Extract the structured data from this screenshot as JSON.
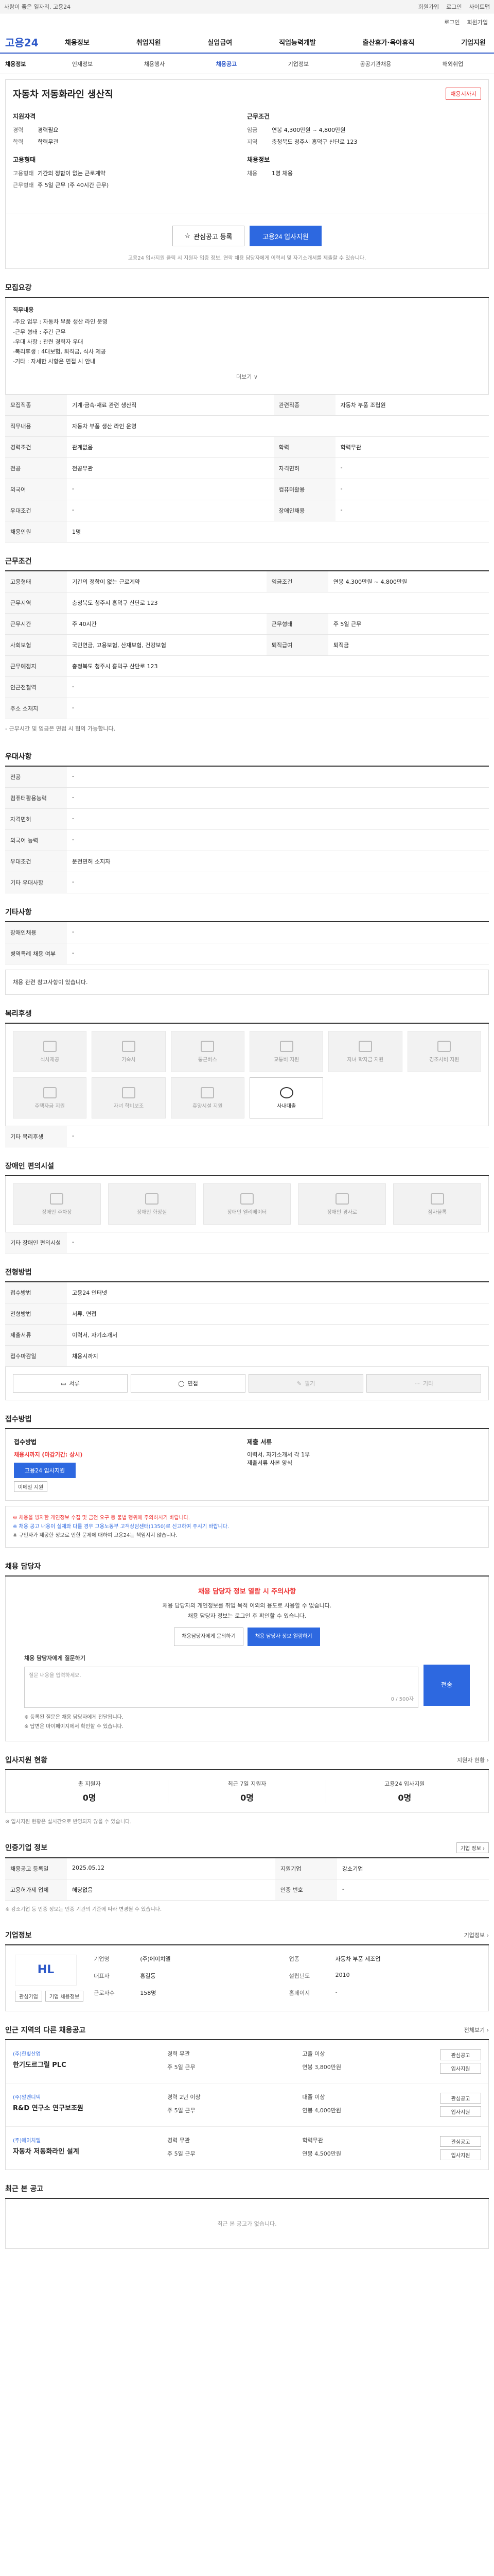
{
  "topbar": {
    "left": "사람이 좋은 일자리, 고용24",
    "items": [
      "회원가입",
      "로그인",
      "사이트맵"
    ]
  },
  "login_row": [
    "로그인",
    "회원가입"
  ],
  "brand": {
    "logo": "고용24"
  },
  "gnb": [
    "채용정보",
    "취업지원",
    "실업급여",
    "직업능력개발",
    "출산휴가·육아휴직",
    "기업지원"
  ],
  "subnav": {
    "title": "채용정보",
    "items": [
      "인재정보",
      "채용행사",
      "채용공고",
      "기업정보",
      "공공기관채용",
      "해외취업"
    ],
    "active": 2
  },
  "job": {
    "title": "자동차 저동화라인 생산직",
    "badge": "채용시까지",
    "left_h": "지원자격",
    "left_rows": [
      [
        "경력",
        "경력필요"
      ],
      [
        "학력",
        "학력무관"
      ]
    ],
    "left_h2": "고용형태",
    "left_rows2": [
      [
        "고용형태",
        "기간의 정함이 없는 근로계약"
      ],
      [
        "근무형태",
        "주 5일 근무 (주 40시간 근무)"
      ]
    ],
    "right_h": "근무조건",
    "right_rows": [
      [
        "임금",
        "연봉 4,300만원 ~ 4,800만원"
      ],
      [
        "지역",
        "충청북도 청주시 흥덕구 산단로 123"
      ]
    ],
    "right_h2": "채용정보",
    "right_rows2": [
      [
        "채용",
        "1명 채용"
      ]
    ],
    "btn_save": "관심공고 등록",
    "btn_apply": "고용24 입사지원",
    "notice": "고용24 입사지원 클릭 시 지원자 입증 정보, 연락 채용 담당자에게 이력서 및 자기소개서를 제출할 수 있습니다."
  },
  "duty": {
    "title": "모집요강",
    "label": "직무내용",
    "lines": [
      "-주요 업무 : 자동차 부품 생산 라인 운영",
      "-근무 형태 : 주간 근무",
      "-우대 사항 : 관련 경력자 우대",
      "-복리후생 : 4대보험, 퇴직금, 식사 제공",
      "-기타 : 자세한 사항은 면접 시 안내"
    ],
    "more": "더보기 ∨",
    "rows": [
      [
        "모집직종",
        "기계·금속·재료 관련 생산직",
        "관련직종",
        "자동차 부품 조립원"
      ],
      [
        "직무내용",
        "자동차 부품 생산 라인 운영",
        "",
        ""
      ],
      [
        "경력조건",
        "관계없음",
        "학력",
        "학력무관"
      ],
      [
        "전공",
        "전공무관",
        "자격면허",
        "-"
      ],
      [
        "외국어",
        "-",
        "컴퓨터활용",
        "-"
      ],
      [
        "우대조건",
        "-",
        "장애인채용",
        "-"
      ],
      [
        "채용인원",
        "1명",
        "",
        ""
      ]
    ]
  },
  "cond": {
    "title": "근무조건",
    "rows": [
      [
        "고용형태",
        "기간의 정함이 없는 근로계약",
        "임금조건",
        "연봉 4,300만원 ~ 4,800만원"
      ],
      [
        "근무지역",
        "충청북도 청주시 흥덕구 산단로 123",
        "",
        ""
      ],
      [
        "근무시간",
        "주 40시간",
        "근무형태",
        "주 5일 근무"
      ],
      [
        "사회보험",
        "국민연금, 고용보험, 산재보험, 건강보험",
        "퇴직급여",
        "퇴직금"
      ],
      [
        "근무예정지",
        "충청북도 청주시 흥덕구 산단로 123",
        "",
        ""
      ],
      [
        "인근전철역",
        "-",
        "",
        ""
      ],
      [
        "주소 소재지",
        "-",
        "",
        ""
      ]
    ],
    "map_btn": "지도 보기",
    "apply_btn": "고용24 입사지원",
    "note": "- 근무시간 및 임금은 면접 시 협의 가능합니다."
  },
  "prefer": {
    "title": "우대사항",
    "rows": [
      [
        "전공",
        "-"
      ],
      [
        "컴퓨터활용능력",
        "-"
      ],
      [
        "자격면허",
        "-"
      ],
      [
        "외국어 능력",
        "-"
      ],
      [
        "우대조건",
        "운전면허 소지자"
      ],
      [
        "기타 우대사항",
        "-"
      ]
    ]
  },
  "extra": {
    "title": "기타사항",
    "rows": [
      [
        "장애인채용",
        "-"
      ],
      [
        "병역특례 채용 여부",
        "-"
      ]
    ],
    "note": "채용 관련 참고사항이 있습니다."
  },
  "welfare": {
    "title": "복리후생",
    "items": [
      "식사제공",
      "기숙사",
      "통근버스",
      "교통비 지원",
      "자녀 학자금 지원",
      "경조사비 지원",
      "주택자금 지원",
      "자녀 학비보조",
      "휴양시설 지원",
      "사내대출"
    ],
    "active_index": 9,
    "etc": "기타 복리후생",
    "etc_val": "-"
  },
  "disab": {
    "title": "장애인 편의시설",
    "items": [
      "장애인 주차장",
      "장애인 화장실",
      "장애인 엘리베이터",
      "장애인 경사로",
      "점자블록"
    ],
    "etc": "기타 장애인 편의시설",
    "etc_val": "-"
  },
  "selection": {
    "title": "전형방법",
    "rows": [
      [
        "접수방법",
        "고용24 인터넷"
      ],
      [
        "전형방법",
        "서류, 면접"
      ],
      [
        "제출서류",
        "이력서, 자기소개서"
      ],
      [
        "접수마감일",
        "채용시까지"
      ]
    ],
    "tabs": [
      "서류",
      "면접",
      "필기",
      "기타"
    ]
  },
  "apply": {
    "title": "접수방법",
    "col1_h": "접수방법",
    "col1_red": "채용시까지 (마감기간: 상시)",
    "col1_btn1": "고용24 입사지원",
    "col1_btn2": "이메일 지원",
    "col2_h": "제출 서류",
    "col2_lines": [
      "이력서, 자기소개서 각 1부",
      "제출서류 사본 양식"
    ]
  },
  "warn": {
    "lines": [
      "※ 채용을 빙자한 개인정보 수집 및 금전 요구 등 불법 행위에 주의하시기 바랍니다.",
      "※ 채용 공고 내용이 실제와 다를 경우 고용노동부 고객상담센터(1350)로 신고하여 주시기 바랍니다.",
      "※ 구인자가 제공한 정보로 인한 문제에 대하여 고용24는 책임지지 않습니다."
    ]
  },
  "contact": {
    "title": "채용 담당자",
    "headline": "채용 담당자 정보 열람 시 주의사항",
    "lines": [
      "채용 담당자의 개인정보를 취업 목적 이외의 용도로 사용할 수 없습니다.",
      "채용 담당자 정보는 로그인 후 확인할 수 있습니다."
    ],
    "btn1": "채용담당자에게 문의하기",
    "btn2": "채용 담당자 정보 열람하기",
    "qa_label": "채용 담당자에게 질문하기",
    "qa_placeholder": "질문 내용을 입력하세요.",
    "qa_count": "0 / 500자",
    "qa_btn": "전송",
    "notes": [
      "※ 등록된 질문은 채용 담당자에게 전달됩니다.",
      "※ 답변은 마이페이지에서 확인할 수 있습니다."
    ]
  },
  "stats": {
    "title": "입사지원 현황",
    "link": "지원자 현황 ›",
    "items": [
      [
        "총 지원자",
        "0명"
      ],
      [
        "최근 7일 지원자",
        "0명"
      ],
      [
        "고용24 입사지원",
        "0명"
      ]
    ],
    "note": "※ 입사지원 현황은 실시간으로 반영되지 않을 수 있습니다."
  },
  "regi": {
    "title": "인증기업 정보",
    "rows": [
      [
        "채용공고 등록일",
        "2025.05.12",
        "지원기업",
        "강소기업"
      ],
      [
        "고용허가제 업체",
        "해당없음",
        "인증 번호",
        "-"
      ]
    ],
    "btn": "기업 정보 ›",
    "note": "※ 강소기업 등 인증 정보는 인증 기관의 기준에 따라 변경될 수 있습니다."
  },
  "company": {
    "title": "기업정보",
    "link": "기업정보 ›",
    "logo": "HL",
    "rows": [
      [
        "기업명",
        "(주)에이치엘",
        "업종",
        "자동차 부품 제조업"
      ],
      [
        "대표자",
        "홍길동",
        "설립년도",
        "2010"
      ],
      [
        "근로자수",
        "158명",
        "홈페이지",
        "-"
      ]
    ],
    "btns": [
      "관심기업",
      "기업 채용정보"
    ]
  },
  "related": {
    "title": "인근 지역의 다른 채용공고",
    "link": "전체보기 ›",
    "items": [
      {
        "company": "(주)한빛산업",
        "title": "한기도르그릴 PLC",
        "tags": [
          "경력 무관",
          "고졸 이상",
          "주 5일 근무",
          "연봉 3,800만원"
        ],
        "btns": [
          "관심공고",
          "입사지원"
        ]
      },
      {
        "company": "(주)알앤디텍",
        "title": "R&D 연구소 연구보조원",
        "tags": [
          "경력 2년 이상",
          "대졸 이상",
          "주 5일 근무",
          "연봉 4,000만원"
        ],
        "btns": [
          "관심공고",
          "입사지원"
        ]
      },
      {
        "company": "(주)에이치엘",
        "title": "자동차 저동화라인 설계",
        "tags": [
          "경력 무관",
          "학력무관",
          "주 5일 근무",
          "연봉 4,500만원"
        ],
        "btns": [
          "관심공고",
          "입사지원"
        ]
      }
    ]
  },
  "recent": {
    "title": "최근 본 공고",
    "empty": "최근 본 공고가 없습니다."
  }
}
